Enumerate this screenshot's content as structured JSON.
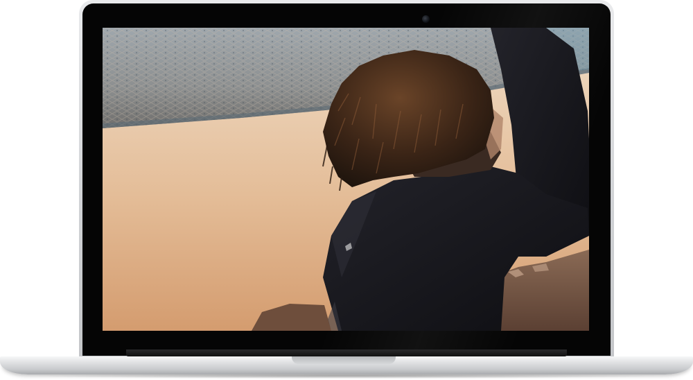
{
  "device": {
    "type": "laptop",
    "frame_color": "#cfd1d4",
    "bezel_color": "#050505"
  },
  "screen_content": {
    "kind": "video-frame",
    "colors": {
      "sky_top": "#e9d2bb",
      "sky_bottom": "#d8a77c",
      "surfboard": "#8a95a0",
      "silhouette": "#16161b",
      "hair": "#4a2e1c",
      "hills": "#7b5a46"
    }
  }
}
